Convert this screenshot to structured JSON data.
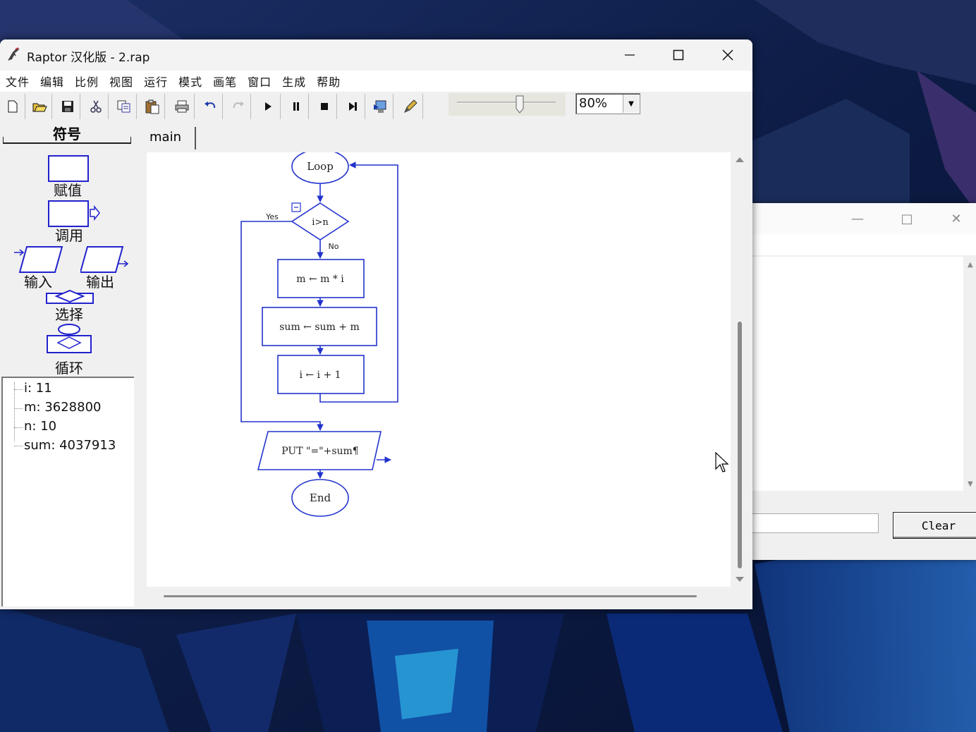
{
  "window": {
    "title": "Raptor 汉化版 - 2.rap"
  },
  "menu": [
    "文件",
    "编辑",
    "比例",
    "视图",
    "运行",
    "模式",
    "画笔",
    "窗口",
    "生成",
    "帮助"
  ],
  "toolbar": {
    "buttons": [
      "new-icon",
      "open-icon",
      "save-icon",
      "cut-icon",
      "copy-icon",
      "paste-icon",
      "print-icon",
      "undo-icon",
      "redo-icon",
      "play-icon",
      "pause-icon",
      "stop-icon",
      "step-icon",
      "test-icon",
      "pen-icon"
    ],
    "zoom_value": "80%"
  },
  "symbols": {
    "header": "符号",
    "assignment": "赋值",
    "call": "调用",
    "input": "输入",
    "output": "输出",
    "selection": "选择",
    "loop": "循环"
  },
  "variables": [
    {
      "text": "i: 11"
    },
    {
      "text": "m: 3628800"
    },
    {
      "text": "n: 10"
    },
    {
      "text": "sum: 4037913"
    }
  ],
  "tabs": {
    "main": "main"
  },
  "flowchart": {
    "loop_label": "Loop",
    "condition": "i>n",
    "yes_label": "Yes",
    "no_label": "No",
    "step1": "m ← m * i",
    "step2": "sum ← sum + m",
    "step3": "i ← i + 1",
    "output": "PUT \"=\"+sum¶",
    "end": "End"
  },
  "console": {
    "clear_label": "Clear"
  }
}
